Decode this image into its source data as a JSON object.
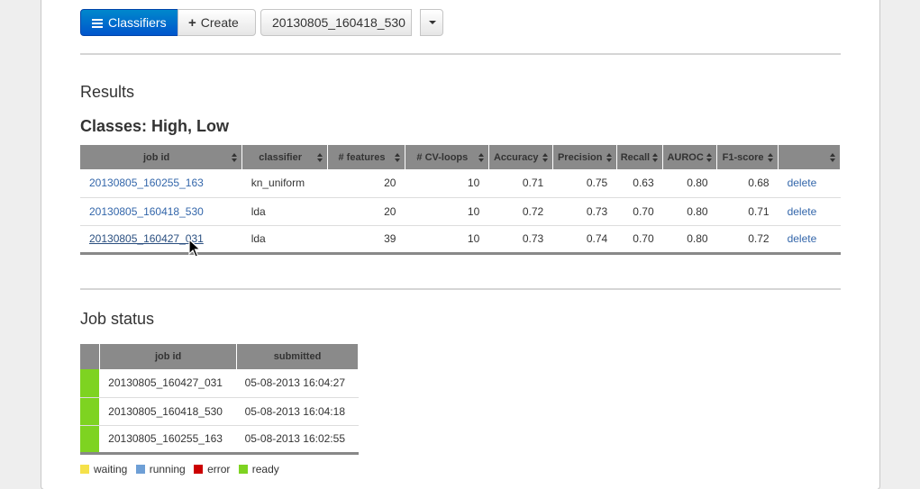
{
  "toolbar": {
    "classifiers_label": "Classifiers",
    "create_label": "Create",
    "job_selector_value": "20130805_160418_530"
  },
  "results": {
    "heading": "Results",
    "classes_heading": "Classes: High, Low",
    "columns": [
      "job id",
      "classifier",
      "# features",
      "# CV-loops",
      "Accuracy",
      "Precision",
      "Recall",
      "AUROC",
      "F1-score",
      ""
    ],
    "rows": [
      {
        "job_id": "20130805_160255_163",
        "classifier": "kn_uniform",
        "features": "20",
        "cv_loops": "10",
        "accuracy": "0.71",
        "precision": "0.75",
        "recall": "0.63",
        "auroc": "0.80",
        "f1": "0.68",
        "action": "delete"
      },
      {
        "job_id": "20130805_160418_530",
        "classifier": "lda",
        "features": "20",
        "cv_loops": "10",
        "accuracy": "0.72",
        "precision": "0.73",
        "recall": "0.70",
        "auroc": "0.80",
        "f1": "0.71",
        "action": "delete"
      },
      {
        "job_id": "20130805_160427_031",
        "classifier": "lda",
        "features": "39",
        "cv_loops": "10",
        "accuracy": "0.73",
        "precision": "0.74",
        "recall": "0.70",
        "auroc": "0.80",
        "f1": "0.72",
        "action": "delete"
      }
    ]
  },
  "job_status": {
    "heading": "Job status",
    "columns": [
      "job id",
      "submitted"
    ],
    "rows": [
      {
        "status": "ready",
        "job_id": "20130805_160427_031",
        "submitted": "05-08-2013 16:04:27"
      },
      {
        "status": "ready",
        "job_id": "20130805_160418_530",
        "submitted": "05-08-2013 16:04:18"
      },
      {
        "status": "ready",
        "job_id": "20130805_160255_163",
        "submitted": "05-08-2013 16:02:55"
      }
    ],
    "legend": [
      {
        "label": "waiting",
        "color": "#f5e14a"
      },
      {
        "label": "running",
        "color": "#6e9fd6"
      },
      {
        "label": "error",
        "color": "#cc0000"
      },
      {
        "label": "ready",
        "color": "#7ed321"
      }
    ]
  },
  "colors": {
    "primary": "#0066cc",
    "header_bg": "#8a8a8a",
    "link": "#3366aa",
    "ready": "#7ed321"
  }
}
